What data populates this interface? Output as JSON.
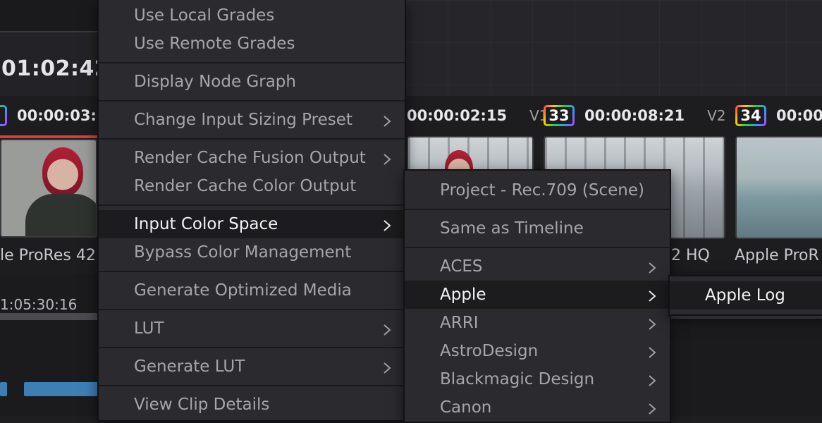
{
  "background": {
    "big_timecode": "01:02:42:",
    "left_clip": {
      "timecode": "00:00:03:0",
      "label": "le ProRes 42"
    },
    "clip_32": {
      "timecode": "00:00:02:15",
      "track": "V1",
      "label": "2 HQ"
    },
    "clip_33": {
      "number": "33",
      "timecode": "00:00:08:21",
      "track": "V2",
      "label": "Apple ProR"
    },
    "clip_34": {
      "number": "34",
      "timecode": "00:00"
    },
    "lower_timecode": "1:05:30:16"
  },
  "context_menu": {
    "items": [
      {
        "label": "Use Local Grades",
        "submenu": false
      },
      {
        "label": "Use Remote Grades",
        "submenu": false
      },
      {
        "label": "Display Node Graph",
        "submenu": false
      },
      {
        "label": "Change Input Sizing Preset",
        "submenu": true
      },
      {
        "label": "Render Cache Fusion Output",
        "submenu": true
      },
      {
        "label": "Render Cache Color Output",
        "submenu": false
      },
      {
        "label": "Input Color Space",
        "submenu": true,
        "highlighted": true
      },
      {
        "label": "Bypass Color Management",
        "submenu": false
      },
      {
        "label": "Generate Optimized Media",
        "submenu": false
      },
      {
        "label": "LUT",
        "submenu": true
      },
      {
        "label": "Generate LUT",
        "submenu": true
      },
      {
        "label": "View Clip Details",
        "submenu": false
      }
    ]
  },
  "color_space_menu": {
    "items": [
      {
        "label": "Project - Rec.709 (Scene)",
        "submenu": false
      },
      {
        "label": "Same as Timeline",
        "submenu": false
      },
      {
        "label": "ACES",
        "submenu": true
      },
      {
        "label": "Apple",
        "submenu": true,
        "highlighted": true
      },
      {
        "label": "ARRI",
        "submenu": true
      },
      {
        "label": "AstroDesign",
        "submenu": true
      },
      {
        "label": "Blackmagic Design",
        "submenu": true
      },
      {
        "label": "Canon",
        "submenu": true
      }
    ]
  },
  "apple_menu": {
    "items": [
      {
        "label": "Apple Log"
      }
    ]
  },
  "colors": {
    "menu_bg": "#2b2b2f",
    "menu_highlight": "#1c1c1f",
    "menu_text": "#a6a6aa",
    "menu_text_active": "#f2f2f4",
    "clip_accent_red": "#e03a3a",
    "timeline_blue": "#3d7fb5"
  }
}
